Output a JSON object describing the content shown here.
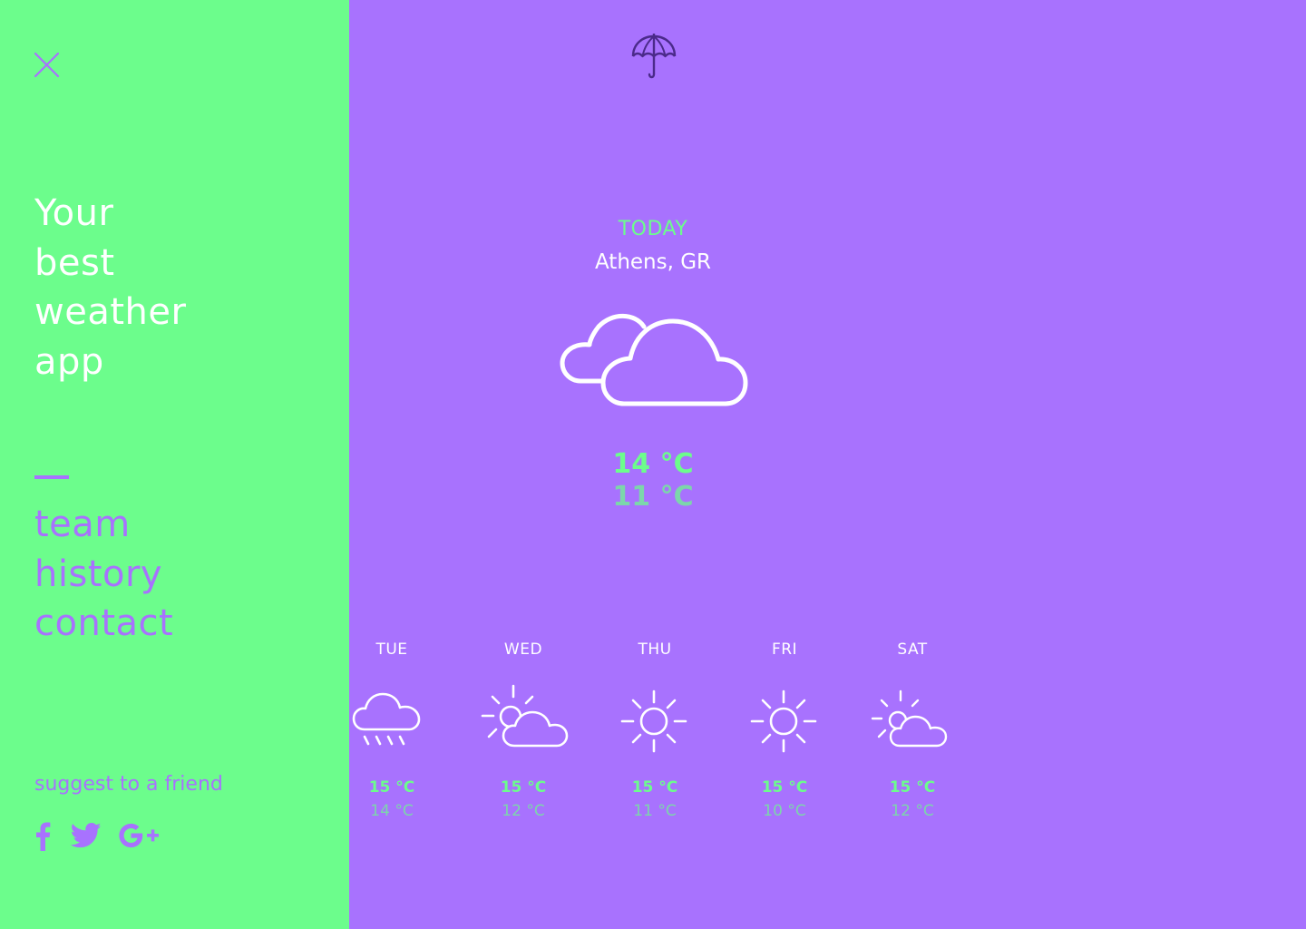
{
  "colors": {
    "sidebar_bg": "#6cfd8c",
    "main_bg": "#a872fe",
    "accent_green": "#6cfd8c",
    "accent_purple": "#a872fe"
  },
  "sidebar": {
    "close_icon": "close-icon",
    "tagline": [
      "Your",
      "best",
      "weather",
      "app"
    ],
    "nav": [
      "team",
      "history",
      "contact"
    ],
    "suggest": "suggest to a friend",
    "socials": [
      "facebook-icon",
      "twitter-icon",
      "google-plus-icon"
    ]
  },
  "main": {
    "logo_icon": "umbrella-icon",
    "today": {
      "label": "TODAY",
      "location": "Athens, GR",
      "icon": "cloudy-icon",
      "high": "14 °C",
      "low": "11 °C"
    },
    "forecast": [
      {
        "day": "TUE",
        "icon": "rain-icon",
        "high": "15 °C",
        "low": "14 °C"
      },
      {
        "day": "WED",
        "icon": "partly-cloudy-icon",
        "high": "15 °C",
        "low": "12 °C"
      },
      {
        "day": "THU",
        "icon": "sun-icon",
        "high": "15 °C",
        "low": "11 °C"
      },
      {
        "day": "FRI",
        "icon": "sun-icon",
        "high": "15 °C",
        "low": "10 °C"
      },
      {
        "day": "SAT",
        "icon": "partly-cloudy-icon",
        "high": "15 °C",
        "low": "12 °C"
      }
    ]
  }
}
